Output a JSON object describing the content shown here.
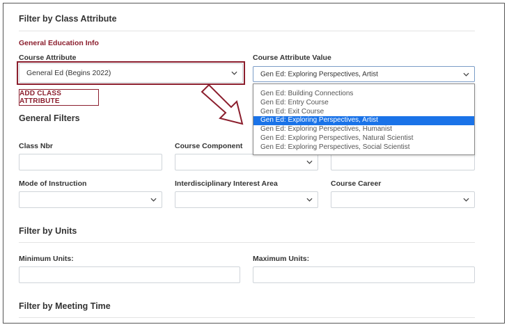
{
  "class_attribute": {
    "title": "Filter by Class Attribute",
    "subheading": "General Education Info",
    "course_attribute_label": "Course Attribute",
    "course_attribute_value": "General Ed (Begins 2022)",
    "attribute_value_label": "Course Attribute Value",
    "attribute_value_selected": "Gen Ed: Exploring Perspectives, Artist",
    "dropdown_options": [
      "Gen Ed: Building Connections",
      "Gen Ed: Entry Course",
      "Gen Ed: Exit Course",
      "Gen Ed: Exploring Perspectives, Artist",
      "Gen Ed: Exploring Perspectives, Humanist",
      "Gen Ed: Exploring Perspectives, Natural Scientist",
      "Gen Ed: Exploring Perspectives, Social Scientist"
    ],
    "add_button": "ADD CLASS ATTRIBUTE"
  },
  "general_filters": {
    "title": "General Filters",
    "class_nbr_label": "Class Nbr",
    "course_component_label": "Course Component",
    "mode_label": "Mode of Instruction",
    "interest_area_label": "Interdisciplinary Interest Area",
    "career_label": "Course Career"
  },
  "units": {
    "title": "Filter by Units",
    "min_label": "Minimum Units:",
    "max_label": "Maximum Units:"
  },
  "meeting_time": {
    "title": "Filter by Meeting Time"
  },
  "colors": {
    "accent": "#8b1e2d",
    "selected_option": "#1a73e8"
  }
}
